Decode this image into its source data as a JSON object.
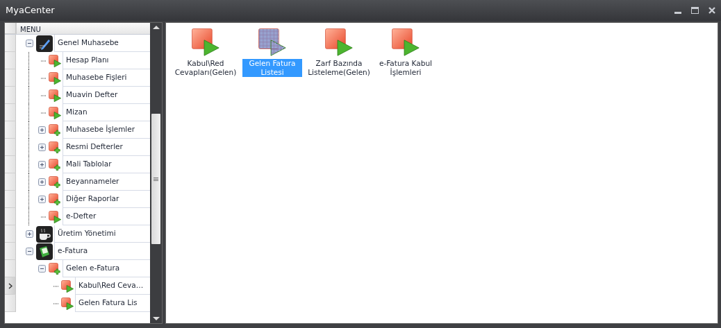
{
  "window": {
    "title": "MyaCenter"
  },
  "menu": {
    "header": "MENU",
    "items": [
      {
        "label": "Genel Muhasebe",
        "kind": "module",
        "expanded": true,
        "selected": false,
        "children": [
          {
            "label": "Hesap Planı",
            "kind": "form",
            "selected": false
          },
          {
            "label": "Muhasebe Fişleri",
            "kind": "form",
            "selected": false
          },
          {
            "label": "Muavin Defter",
            "kind": "form",
            "selected": false
          },
          {
            "label": "Mizan",
            "kind": "form",
            "selected": false
          },
          {
            "label": "Muhasebe İşlemler",
            "kind": "folder",
            "expanded": false,
            "selected": false
          },
          {
            "label": "Resmi Defterler",
            "kind": "folder",
            "expanded": false,
            "selected": false
          },
          {
            "label": "Mali Tablolar",
            "kind": "folder",
            "expanded": false,
            "selected": false
          },
          {
            "label": "Beyannameler",
            "kind": "folder",
            "expanded": false,
            "selected": false
          },
          {
            "label": "Diğer Raporlar",
            "kind": "folder",
            "expanded": false,
            "selected": false
          },
          {
            "label": "e-Defter",
            "kind": "form",
            "selected": false
          }
        ]
      },
      {
        "label": "Üretim Yönetimi",
        "kind": "module",
        "expanded": false,
        "selected": false
      },
      {
        "label": "e-Fatura",
        "kind": "module",
        "expanded": true,
        "selected": false,
        "children": [
          {
            "label": "Gelen e-Fatura",
            "kind": "folder",
            "expanded": true,
            "selected": false,
            "children": [
              {
                "label": "Kabul\\Red Ceva…",
                "kind": "form",
                "selected": true
              },
              {
                "label": "Gelen Fatura Lis",
                "kind": "form",
                "selected": false
              }
            ]
          }
        ]
      }
    ]
  },
  "tiles": [
    {
      "label": "Kabul\\Red Cevapları(Gelen)",
      "selected": false
    },
    {
      "label": "Gelen Fatura Listesi",
      "selected": true
    },
    {
      "label": "Zarf Bazında Listeleme(Gelen)",
      "selected": false
    },
    {
      "label": "e-Fatura Kabul İşlemleri",
      "selected": false
    }
  ]
}
